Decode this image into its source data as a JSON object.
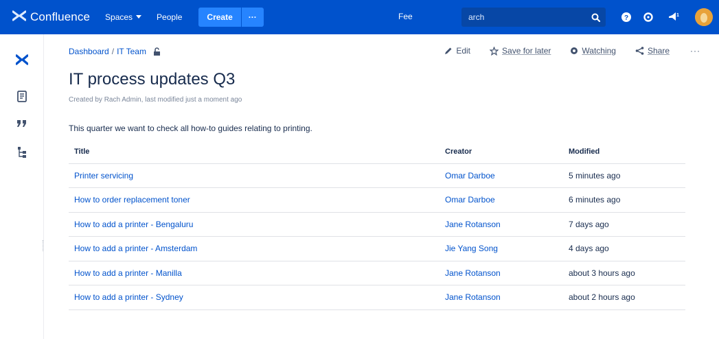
{
  "topbar": {
    "app_name": "Confluence",
    "nav": {
      "spaces": "Spaces",
      "people": "People"
    },
    "create_label": "Create",
    "create_more_label": "···",
    "feedback_label": "Fee",
    "search_placeholder": "arch"
  },
  "breadcrumb": {
    "dashboard": "Dashboard",
    "separator": "/",
    "space": "IT Team"
  },
  "actions": {
    "edit": "Edit",
    "save_for_later": "Save for later",
    "watching": "Watching",
    "share": "Share",
    "more": "···"
  },
  "page": {
    "title": "IT process updates Q3",
    "byline": "Created by Rach Admin, last modified just a moment ago",
    "intro": "This quarter we want to check all how-to guides relating to printing."
  },
  "table": {
    "headers": [
      "Title",
      "Creator",
      "Modified"
    ],
    "rows": [
      {
        "title": "Printer servicing",
        "creator": "Omar Darboe",
        "modified": "5 minutes ago"
      },
      {
        "title": "How to order replacement toner",
        "creator": "Omar Darboe",
        "modified": "6 minutes ago"
      },
      {
        "title": "How to add a printer - Bengaluru",
        "creator": "Jane Rotanson",
        "modified": "7 days ago"
      },
      {
        "title": "How to add a printer - Amsterdam",
        "creator": "Jie Yang Song",
        "modified": "4 days ago"
      },
      {
        "title": "How to add a printer - Manilla",
        "creator": "Jane Rotanson",
        "modified": "about 3 hours ago"
      },
      {
        "title": "How to add a printer - Sydney",
        "creator": "Jane Rotanson",
        "modified": "about 2 hours ago"
      }
    ]
  },
  "icons": {
    "logo": "confluence-logo-icon",
    "search": "search-icon",
    "help": "help-icon",
    "settings": "gear-icon",
    "notifications": "notification-icon",
    "sidebar": [
      "confluence-logo-icon",
      "pages-icon",
      "blog-quote-icon",
      "page-tree-icon"
    ]
  },
  "colors": {
    "brand": "#0052cc",
    "create": "#2684ff",
    "link": "#0052cc"
  }
}
